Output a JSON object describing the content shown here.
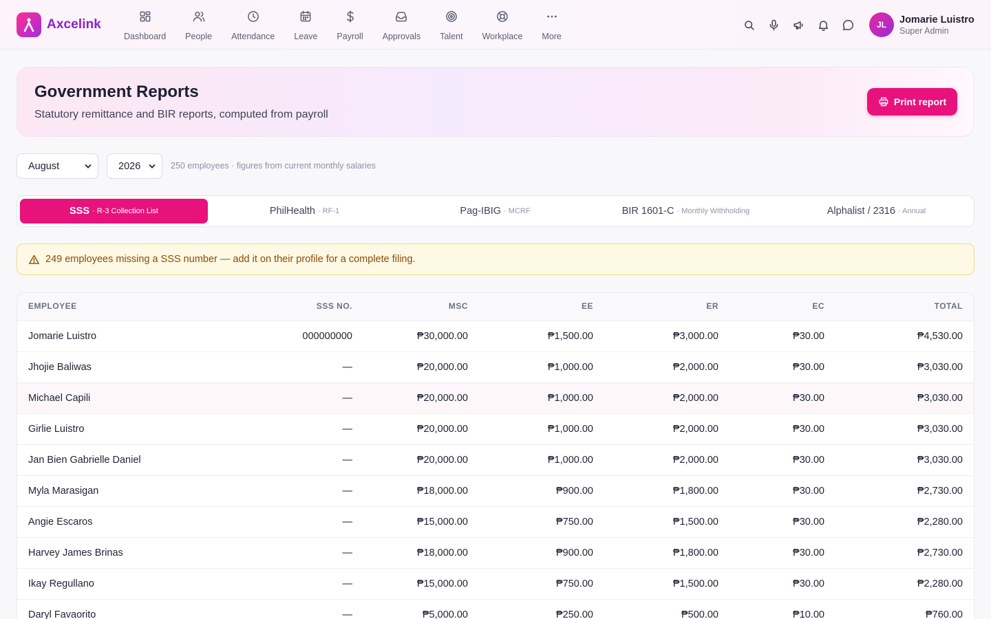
{
  "brand": {
    "name": "Axcelink"
  },
  "nav": [
    {
      "label": "Dashboard",
      "icon": "dashboard-icon"
    },
    {
      "label": "People",
      "icon": "people-icon"
    },
    {
      "label": "Attendance",
      "icon": "clock-icon"
    },
    {
      "label": "Leave",
      "icon": "calendar-icon"
    },
    {
      "label": "Payroll",
      "icon": "dollar-icon"
    },
    {
      "label": "Approvals",
      "icon": "inbox-icon"
    },
    {
      "label": "Talent",
      "icon": "target-icon"
    },
    {
      "label": "Workplace",
      "icon": "lifebuoy-icon"
    },
    {
      "label": "More",
      "icon": "more-icon"
    }
  ],
  "header_actions": [
    "search-icon",
    "microphone-icon",
    "megaphone-icon",
    "bell-icon",
    "chat-icon"
  ],
  "user": {
    "initials": "JL",
    "name": "Jomarie Luistro",
    "role": "Super Admin"
  },
  "page": {
    "title": "Government Reports",
    "subtitle": "Statutory remittance and BIR reports, computed from payroll",
    "print_label": "Print report"
  },
  "filters": {
    "month": "August",
    "year": "2026",
    "note": "250 employees · figures from current monthly salaries"
  },
  "tabs": [
    {
      "label": "SSS",
      "sub": "· R-3 Collection List",
      "active": true
    },
    {
      "label": "PhilHealth",
      "sub": "· RF-1",
      "active": false
    },
    {
      "label": "Pag-IBIG",
      "sub": "· MCRF",
      "active": false
    },
    {
      "label": "BIR 1601-C",
      "sub": "· Monthly Withholding",
      "active": false
    },
    {
      "label": "Alphalist / 2316",
      "sub": "· Annual",
      "active": false
    }
  ],
  "warning": "249 employees missing a SSS number — add it on their profile for a complete filing.",
  "table": {
    "columns": [
      "EMPLOYEE",
      "SSS NO.",
      "MSC",
      "EE",
      "ER",
      "EC",
      "TOTAL"
    ],
    "rows": [
      [
        "Jomarie Luistro",
        "000000000",
        "₱30,000.00",
        "₱1,500.00",
        "₱3,000.00",
        "₱30.00",
        "₱4,530.00"
      ],
      [
        "Jhojie Baliwas",
        "—",
        "₱20,000.00",
        "₱1,000.00",
        "₱2,000.00",
        "₱30.00",
        "₱3,030.00"
      ],
      [
        "Michael Capili",
        "—",
        "₱20,000.00",
        "₱1,000.00",
        "₱2,000.00",
        "₱30.00",
        "₱3,030.00"
      ],
      [
        "Girlie Luistro",
        "—",
        "₱20,000.00",
        "₱1,000.00",
        "₱2,000.00",
        "₱30.00",
        "₱3,030.00"
      ],
      [
        "Jan Bien Gabrielle Daniel",
        "—",
        "₱20,000.00",
        "₱1,000.00",
        "₱2,000.00",
        "₱30.00",
        "₱3,030.00"
      ],
      [
        "Myla Marasigan",
        "—",
        "₱18,000.00",
        "₱900.00",
        "₱1,800.00",
        "₱30.00",
        "₱2,730.00"
      ],
      [
        "Angie Escaros",
        "—",
        "₱15,000.00",
        "₱750.00",
        "₱1,500.00",
        "₱30.00",
        "₱2,280.00"
      ],
      [
        "Harvey James Brinas",
        "—",
        "₱18,000.00",
        "₱900.00",
        "₱1,800.00",
        "₱30.00",
        "₱2,730.00"
      ],
      [
        "Ikay Regullano",
        "—",
        "₱15,000.00",
        "₱750.00",
        "₱1,500.00",
        "₱30.00",
        "₱2,280.00"
      ],
      [
        "Daryl Favaorito",
        "—",
        "₱5,000.00",
        "₱250.00",
        "₱500.00",
        "₱10.00",
        "₱760.00"
      ]
    ]
  },
  "colors": {
    "accent": "#e8127c",
    "brand": "#8b23c9",
    "warning_bg": "#fef9e4",
    "warning_text": "#8a4b08"
  }
}
